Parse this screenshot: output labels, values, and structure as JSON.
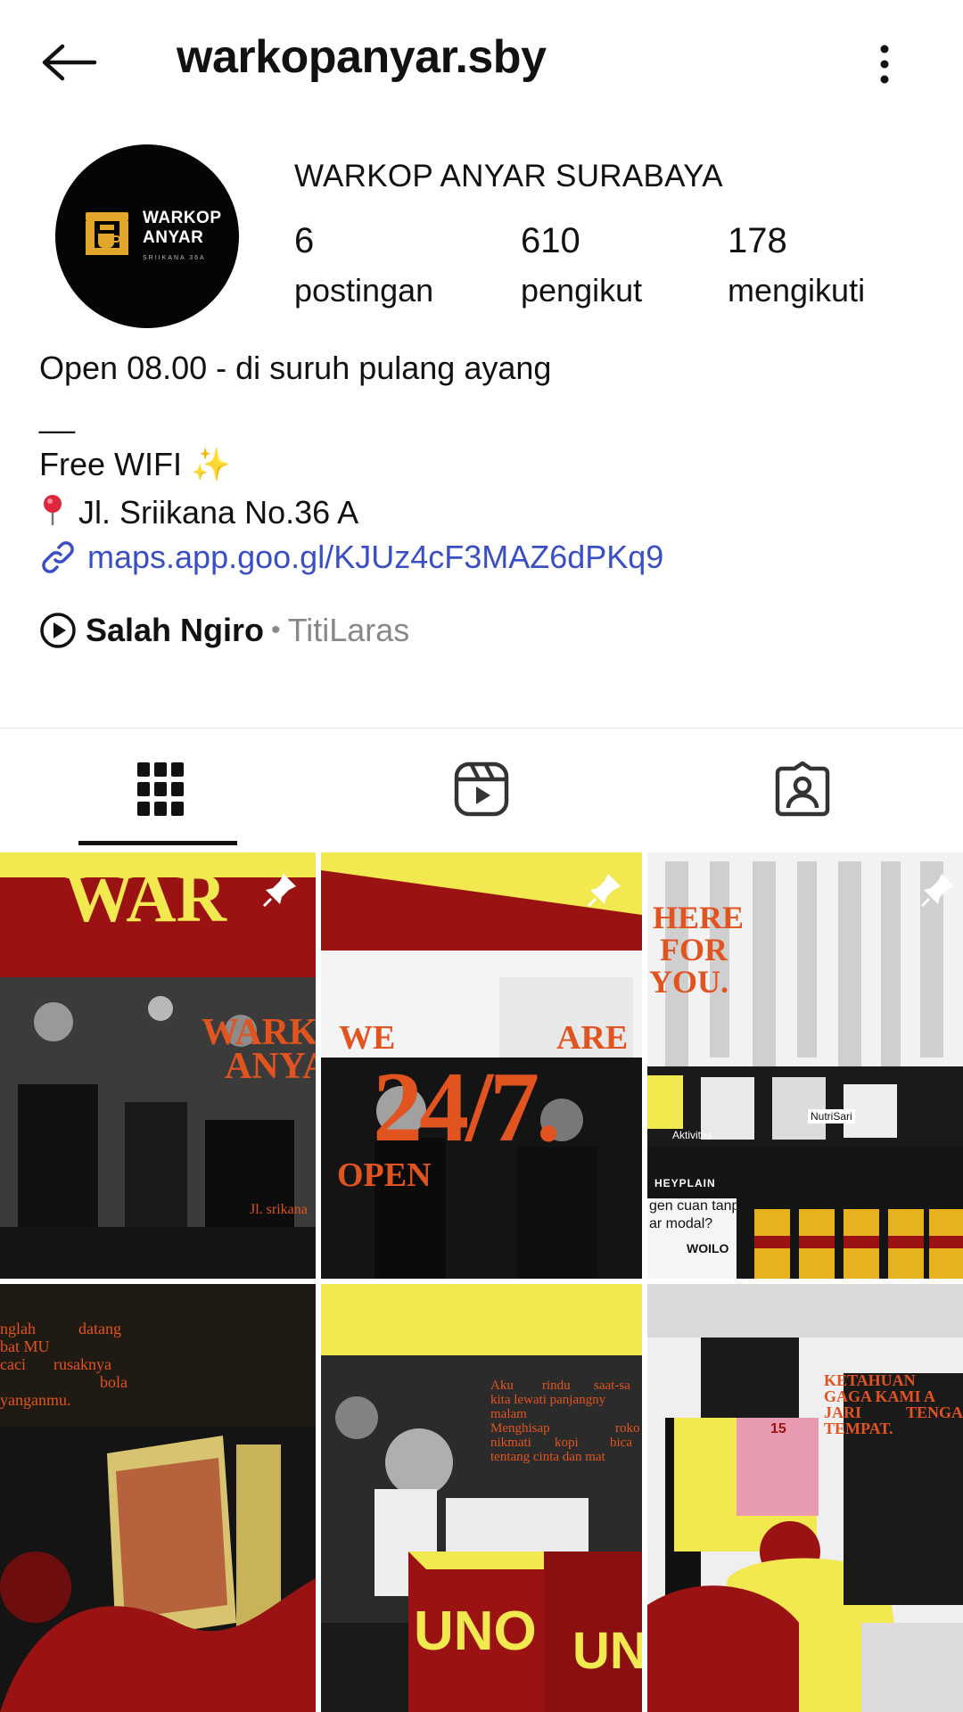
{
  "header": {
    "username": "warkopanyar.sby",
    "back_icon": "arrow-left-icon",
    "more_icon": "more-vertical-icon"
  },
  "profile": {
    "avatar": {
      "line1": "WARKOP",
      "line2": "ANYAR",
      "line3": "SRIIKANA 36A"
    },
    "display_name": "WARKOP ANYAR SURABAYA",
    "stats": {
      "posts": {
        "value": "6",
        "label": "postingan"
      },
      "followers": {
        "value": "610",
        "label": "pengikut"
      },
      "following": {
        "value": "178",
        "label": "mengikuti"
      }
    }
  },
  "bio": {
    "hours": "Open 08.00 - di suruh pulang ayang",
    "separator": "__",
    "wifi": "Free WIFI",
    "wifi_emoji": "✨",
    "address": "Jl. Sriikana No.36 A",
    "link": "maps.app.goo.gl/KJUz4cF3MAZ6dPKq9"
  },
  "music": {
    "title": "Salah Ngiro",
    "separator": "•",
    "artist": "TitiLaras"
  },
  "tabs": [
    {
      "name": "posts-grid",
      "icon": "grid-icon",
      "active": true
    },
    {
      "name": "reels",
      "icon": "reels-icon",
      "active": false
    },
    {
      "name": "tagged",
      "icon": "tagged-person-icon",
      "active": false
    }
  ],
  "posts": [
    {
      "pinned": true,
      "lines": [
        "WAR",
        "WARKO",
        "ANYA",
        "Jl. srikana"
      ]
    },
    {
      "pinned": true,
      "lines": [
        "WE",
        "ARE",
        "24/7.",
        "OPEN"
      ]
    },
    {
      "pinned": true,
      "lines": [
        "HERE",
        "FOR",
        "YOU.",
        "gen cuan tanpa",
        "ar modal?",
        "Aktivitas",
        "HEYPLAIN",
        "WOILO",
        "NutriSari"
      ]
    },
    {
      "pinned": false,
      "lines": [
        "nglah",
        "datang",
        "bat MU",
        "caci",
        "rusaknya",
        "bola",
        "yanganmu."
      ]
    },
    {
      "pinned": false,
      "lines": [
        "Aku",
        "rindu",
        "saat-sa",
        "kita lewati panjangny",
        "malam",
        "Menghisap",
        "roko",
        "nikmati",
        "kopi",
        "bica",
        "tentang cinta dan mat",
        "UNO",
        "UN"
      ]
    },
    {
      "pinned": false,
      "lines": [
        "KETAHUAN",
        "GAGA KAMI A",
        "JARI",
        "TENGA",
        "TEMPAT.",
        "15"
      ]
    }
  ],
  "colors": {
    "link": "#3b4fc4",
    "secondary_text": "#888888",
    "poster_red": "#9b1212",
    "poster_yellow": "#f2e84f",
    "poster_orange": "#e2541f"
  }
}
